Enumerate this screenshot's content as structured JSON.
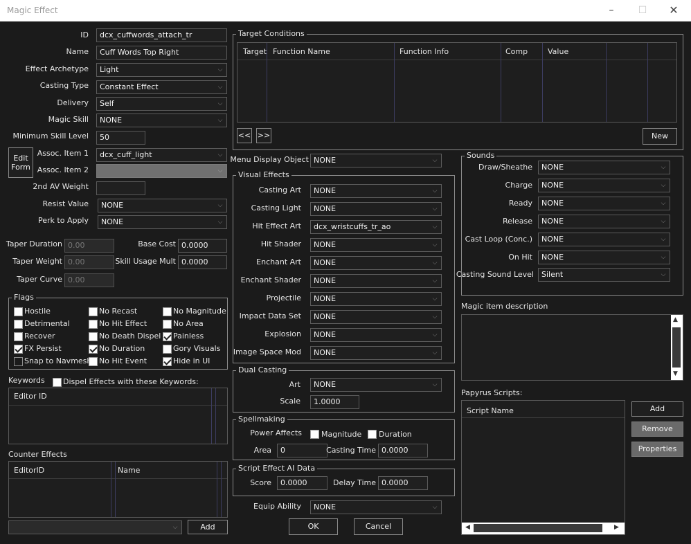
{
  "window": {
    "title": "Magic Effect"
  },
  "main": {
    "id_label": "ID",
    "id_value": "dcx_cuffwords_attach_tr",
    "name_label": "Name",
    "name_value": "Cuff Words Top Right",
    "archetype_label": "Effect Archetype",
    "archetype_value": "Light",
    "casting_type_label": "Casting Type",
    "casting_type_value": "Constant Effect",
    "delivery_label": "Delivery",
    "delivery_value": "Self",
    "magic_skill_label": "Magic Skill",
    "magic_skill_value": "NONE",
    "min_skill_label": "Minimum Skill Level",
    "min_skill_value": "50",
    "edit_form_label": "Edit\nForm",
    "assoc1_label": "Assoc. Item 1",
    "assoc1_value": "dcx_cuff_light",
    "assoc2_label": "Assoc. Item 2",
    "assoc2_value": "",
    "av2_label": "2nd AV Weight",
    "av2_value": "",
    "resist_label": "Resist Value",
    "resist_value": "NONE",
    "perk_label": "Perk to Apply",
    "perk_value": "NONE",
    "taper_duration_label": "Taper Duration",
    "taper_duration_value": "0.00",
    "taper_weight_label": "Taper Weight",
    "taper_weight_value": "0.00",
    "taper_curve_label": "Taper Curve",
    "taper_curve_value": "0.00",
    "base_cost_label": "Base Cost",
    "base_cost_value": "0.0000",
    "skill_mult_label": "Skill Usage Mult",
    "skill_mult_value": "0.0000"
  },
  "flags": {
    "title": "Flags",
    "items": [
      {
        "label": "Hostile",
        "checked": false
      },
      {
        "label": "No Recast",
        "checked": false
      },
      {
        "label": "No Magnitude",
        "checked": false
      },
      {
        "label": "Detrimental",
        "checked": false
      },
      {
        "label": "No Hit Effect",
        "checked": false
      },
      {
        "label": "No Area",
        "checked": false
      },
      {
        "label": "Recover",
        "checked": false
      },
      {
        "label": "No Death Dispel",
        "checked": false
      },
      {
        "label": "Painless",
        "checked": true
      },
      {
        "label": "FX Persist",
        "checked": true
      },
      {
        "label": "No Duration",
        "checked": true
      },
      {
        "label": "Gory Visuals",
        "checked": false
      },
      {
        "label": "Snap to Navmesh",
        "checked": false
      },
      {
        "label": "No Hit Event",
        "checked": false
      },
      {
        "label": "Hide in UI",
        "checked": true
      }
    ]
  },
  "keywords": {
    "title": "Keywords",
    "dispel_label": "Dispel Effects with these Keywords:",
    "col": "Editor ID"
  },
  "counter": {
    "title": "Counter Effects",
    "col1": "EditorID",
    "col2": "Name",
    "add": "Add",
    "combo_value": ""
  },
  "target": {
    "title": "Target Conditions",
    "cols": [
      "Target",
      "Function Name",
      "Function Info",
      "Comp",
      "Value"
    ],
    "prev": "<<",
    "next": ">>",
    "new": "New"
  },
  "menu_display": {
    "label": "Menu Display Object",
    "value": "NONE"
  },
  "visual": {
    "title": "Visual Effects",
    "items": [
      {
        "label": "Casting Art",
        "value": "NONE"
      },
      {
        "label": "Casting Light",
        "value": "NONE"
      },
      {
        "label": "Hit Effect Art",
        "value": "dcx_wristcuffs_tr_ao"
      },
      {
        "label": "Hit Shader",
        "value": "NONE"
      },
      {
        "label": "Enchant Art",
        "value": "NONE"
      },
      {
        "label": "Enchant Shader",
        "value": "NONE"
      },
      {
        "label": "Projectile",
        "value": "NONE"
      },
      {
        "label": "Impact Data Set",
        "value": "NONE"
      },
      {
        "label": "Explosion",
        "value": "NONE"
      },
      {
        "label": "Image Space Mod",
        "value": "NONE"
      }
    ]
  },
  "dual": {
    "title": "Dual Casting",
    "art_label": "Art",
    "art_value": "NONE",
    "scale_label": "Scale",
    "scale_value": "1.0000"
  },
  "spell": {
    "title": "Spellmaking",
    "power_label": "Power Affects",
    "magnitude": "Magnitude",
    "duration": "Duration",
    "area_label": "Area",
    "area_value": "0",
    "ctime_label": "Casting Time",
    "ctime_value": "0.0000"
  },
  "ai": {
    "title": "Script Effect AI Data",
    "score_label": "Score",
    "score_value": "0.0000",
    "delay_label": "Delay Time",
    "delay_value": "0.0000"
  },
  "equip": {
    "label": "Equip Ability",
    "value": "NONE"
  },
  "buttons": {
    "ok": "OK",
    "cancel": "Cancel"
  },
  "sounds": {
    "title": "Sounds",
    "items": [
      {
        "label": "Draw/Sheathe",
        "value": "NONE"
      },
      {
        "label": "Charge",
        "value": "NONE"
      },
      {
        "label": "Ready",
        "value": "NONE"
      },
      {
        "label": "Release",
        "value": "NONE"
      },
      {
        "label": "Cast Loop (Conc.)",
        "value": "NONE"
      },
      {
        "label": "On Hit",
        "value": "NONE"
      }
    ],
    "level_label": "Casting Sound Level",
    "level_value": "Silent"
  },
  "description": {
    "title": "Magic item description"
  },
  "papyrus": {
    "title": "Papyrus Scripts:",
    "col": "Script Name",
    "add": "Add",
    "remove": "Remove",
    "properties": "Properties"
  }
}
